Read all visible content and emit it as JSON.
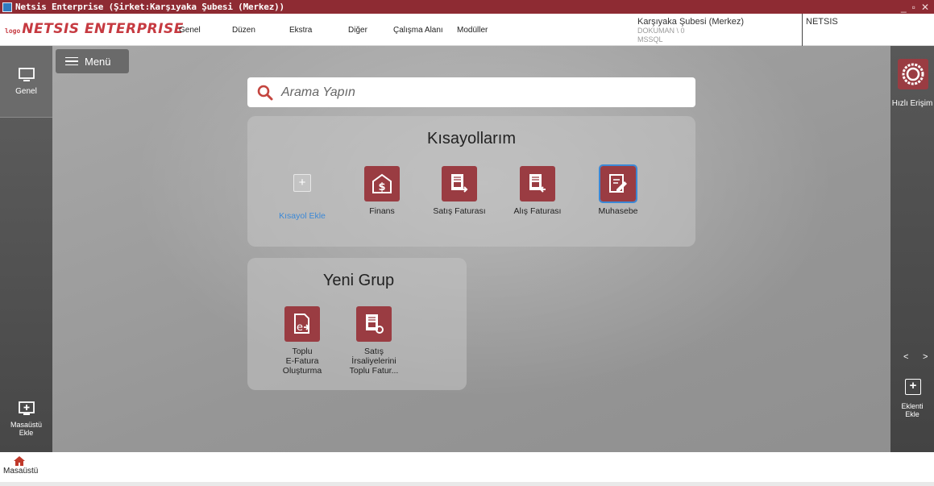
{
  "window": {
    "title": "Netsis Enterprise (Şirket:Karşıyaka Şubesi (Merkez))",
    "controls": [
      "_",
      "▫",
      "✕"
    ]
  },
  "brand": {
    "logo_small": "logo",
    "logo_main": "NETSIS ENTERPRISE",
    "color": "#c63a41"
  },
  "menu": {
    "items": [
      "Genel",
      "Düzen",
      "Ekstra",
      "Diğer",
      "Çalışma Alanı",
      "Modüller"
    ]
  },
  "company": {
    "name": "Karşıyaka Şubesi (Merkez)",
    "db": "DOKUMAN \\ 0",
    "server": "MSSQL"
  },
  "user": {
    "name": "NETSIS"
  },
  "left_panel": {
    "genel_label": "Genel",
    "add_desktop_label_1": "Masaüstü",
    "add_desktop_label_2": "Ekle"
  },
  "menu_button": {
    "label": "Menü"
  },
  "search": {
    "placeholder": "Arama Yapın"
  },
  "groups": [
    {
      "title": "Kısayollarım",
      "add_label": "Kısayol Ekle",
      "tiles": [
        {
          "label": "Finans",
          "icon": "dollar-box-icon"
        },
        {
          "label": "Satış Faturası",
          "icon": "sales-invoice-icon"
        },
        {
          "label": "Alış Faturası",
          "icon": "purchase-invoice-icon"
        },
        {
          "label": "Muhasebe",
          "icon": "accounting-icon",
          "selected": true
        }
      ]
    },
    {
      "title": "Yeni Grup",
      "tiles": [
        {
          "label_lines": [
            "Toplu",
            "E-Fatura",
            "Oluşturma"
          ],
          "icon": "e-invoice-icon"
        },
        {
          "label_lines": [
            "Satış",
            "İrsaliyelerini",
            "Toplu Fatur..."
          ],
          "icon": "waybill-to-invoice-icon"
        }
      ]
    }
  ],
  "right_panel": {
    "quick_access_label": "Hızlı Erişim",
    "nav_prev": "<",
    "nav_next": ">",
    "add_plugin_label_1": "Eklenti",
    "add_plugin_label_2": "Ekle"
  },
  "taskbar": {
    "home_label": "Masaüstü"
  },
  "colors": {
    "titlebar": "#8e2b33",
    "tile": "#9a3c42",
    "accent_blue": "#3b88d6",
    "home_icon": "#c0392b"
  }
}
